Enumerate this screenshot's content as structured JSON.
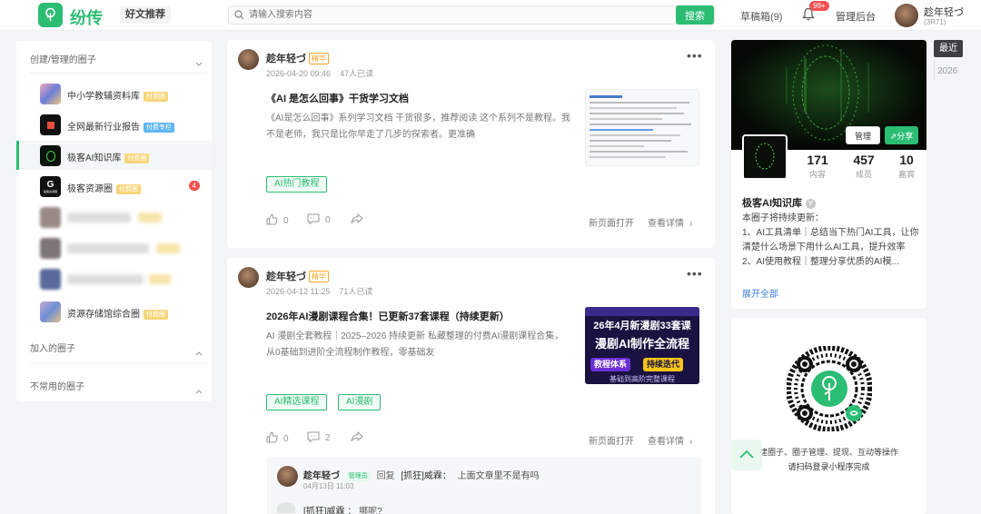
{
  "header": {
    "logo_text": "纷传",
    "good_articles": "好文推荐",
    "search_placeholder": "请输入搜索内容",
    "search_button": "搜索",
    "drafts": "草稿箱(9)",
    "notification_count": "99+",
    "admin": "管理后台",
    "user_name": "趁年轻づ",
    "user_id": "(3R71)"
  },
  "sidebar": {
    "section_created": "创建/管理的圈子",
    "section_joined": "加入的圈子",
    "section_unused": "不常用的圈子",
    "items": [
      {
        "label": "中小学教辅资料库",
        "tag": "付费圈"
      },
      {
        "label": "全网最新行业报告",
        "tag": "付费专栏"
      },
      {
        "label": "极客AI知识库",
        "tag": "付费圈"
      },
      {
        "label": "极客资源圈",
        "tag": "付费圈",
        "count": "4"
      },
      {
        "label": "资源存储馆综合圈",
        "tag": "付费圈"
      }
    ],
    "logo_caption": "极客资源圈"
  },
  "posts": [
    {
      "author": "趁年轻づ",
      "badge": "精华",
      "date": "2026-04-20 09:46",
      "reads": "47人已读",
      "title": "《AI 是怎么回事》干货学习文档",
      "body": "《AI是怎么回事》系列学习文档 干货很多，推荐阅读 这个系列不是教程。我不是老师，我只是比你早走了几步的探索者。更准确",
      "tags": [
        "AI热门教程"
      ],
      "likes": "0",
      "comments": "0",
      "open_new": "新页面打开",
      "view_detail": "查看详情"
    },
    {
      "author": "趁年轻づ",
      "badge": "精华",
      "date": "2026-04-12 11:25",
      "reads": "71人已读",
      "title": "2026年AI漫剧课程合集！已更新37套课程（持续更新）",
      "body": "AI 漫剧全套教程｜2025–2026 持续更新 私藏整理的付费AI漫剧课程合集，从0基础到进阶全流程制作教程，零基础友",
      "tags": [
        "AI精选课程",
        "AI漫剧"
      ],
      "likes": "0",
      "comments": "2",
      "open_new": "新页面打开",
      "view_detail": "查看详情",
      "thumb_line1": "26年4月新漫剧33套课",
      "thumb_line2": "漫剧AI制作全流程",
      "thumb_pill1": "教程体系",
      "thumb_pill2": "持续迭代",
      "thumb_bottom": "基础到高阶完整课程"
    }
  ],
  "comment": {
    "author": "趁年轻づ",
    "role": "管理员",
    "reply_word": "回复",
    "reply_to": "[抓狂]威霖：",
    "text": "上面文章里不是有吗",
    "time": "04月13日 11:03",
    "second_author": "[抓狂]威霖",
    "second_text": "： 哪呢?"
  },
  "group": {
    "manage": "管理",
    "share": "分享",
    "stats": [
      {
        "num": "171",
        "label": "内容"
      },
      {
        "num": "457",
        "label": "成员"
      },
      {
        "num": "10",
        "label": "嘉宾"
      }
    ],
    "name": "极客AI知识库",
    "verified": "V",
    "desc_line1": "本圈子将持续更新：",
    "desc_line2": "1、AI工具清单｜总结当下热门AI工具，让你清楚什么场景下用什么AI工具，提升效率",
    "desc_line3": "2、AI使用教程｜整理分享优质的AI模...",
    "expand": "展开全部"
  },
  "qr": {
    "line1": "建圈子、圈子管理、提现、互动等操作",
    "line2": "请扫码登录小程序完成"
  },
  "timeline": {
    "recent": "最近",
    "year": "2026"
  },
  "colors": {
    "brand": "#2bbd73",
    "badge_red": "#f25050",
    "essence": "#f5a623"
  }
}
